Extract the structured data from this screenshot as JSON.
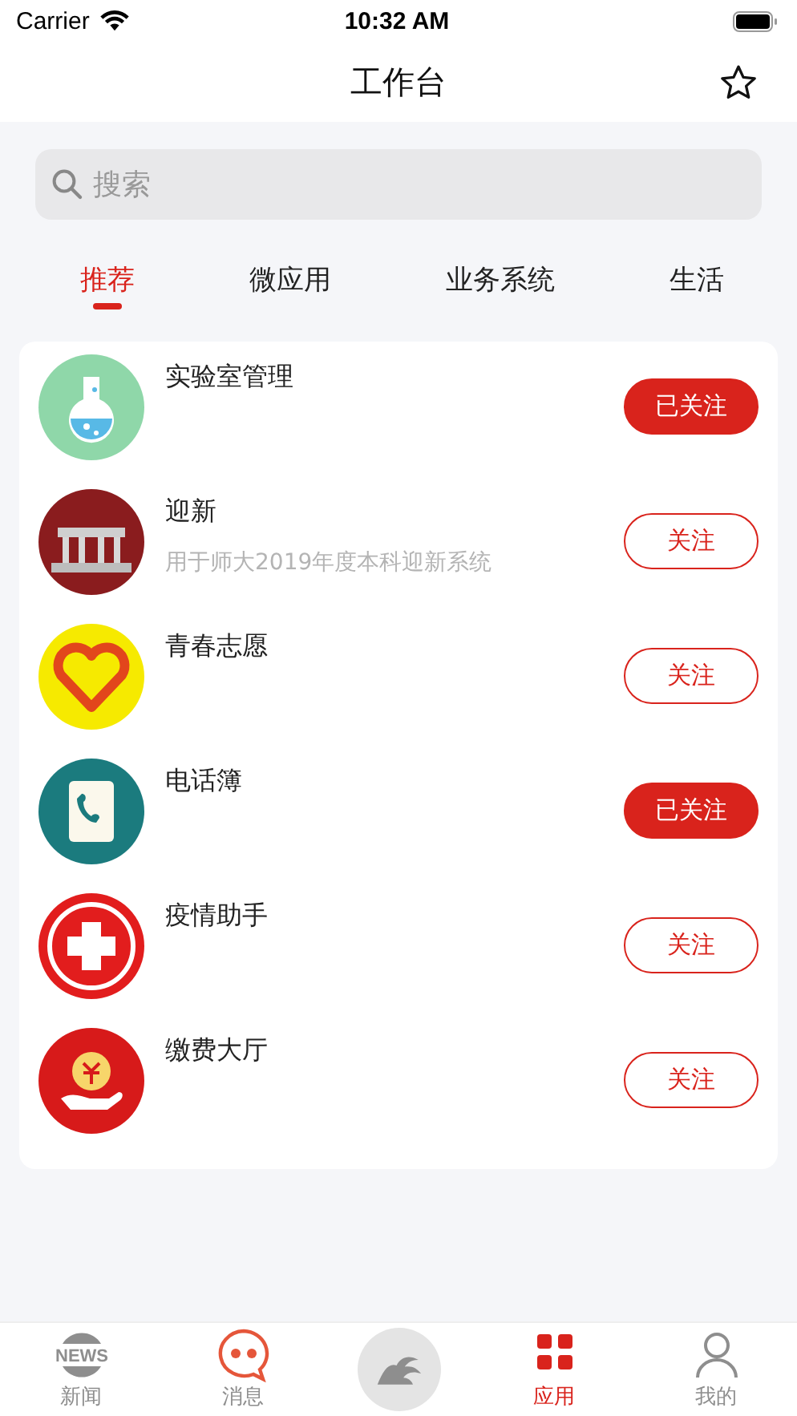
{
  "status_bar": {
    "carrier": "Carrier",
    "time": "10:32 AM"
  },
  "nav": {
    "title": "工作台"
  },
  "search": {
    "placeholder": "搜索"
  },
  "tabs": [
    {
      "label": "推荐",
      "selected": true
    },
    {
      "label": "微应用",
      "selected": false
    },
    {
      "label": "业务系统",
      "selected": false
    },
    {
      "label": "生活",
      "selected": false
    }
  ],
  "apps": [
    {
      "name": "实验室管理",
      "followed": true,
      "button": "已关注"
    },
    {
      "name": "迎新",
      "description": "用于师大2019年度本科迎新系统",
      "followed": false,
      "button": "关注"
    },
    {
      "name": "青春志愿",
      "followed": false,
      "button": "关注"
    },
    {
      "name": "电话簿",
      "followed": true,
      "button": "已关注"
    },
    {
      "name": "疫情助手",
      "followed": false,
      "button": "关注"
    },
    {
      "name": "缴费大厅",
      "followed": false,
      "button": "关注"
    }
  ],
  "tab_bar": [
    {
      "kind": "tab",
      "label": "新闻",
      "icon_text": "NEWS",
      "selected": false
    },
    {
      "kind": "tab",
      "label": "消息",
      "selected": false
    },
    {
      "kind": "center",
      "selected": false
    },
    {
      "kind": "tab",
      "label": "应用",
      "selected": true
    },
    {
      "kind": "tab",
      "label": "我的",
      "selected": false
    }
  ]
}
